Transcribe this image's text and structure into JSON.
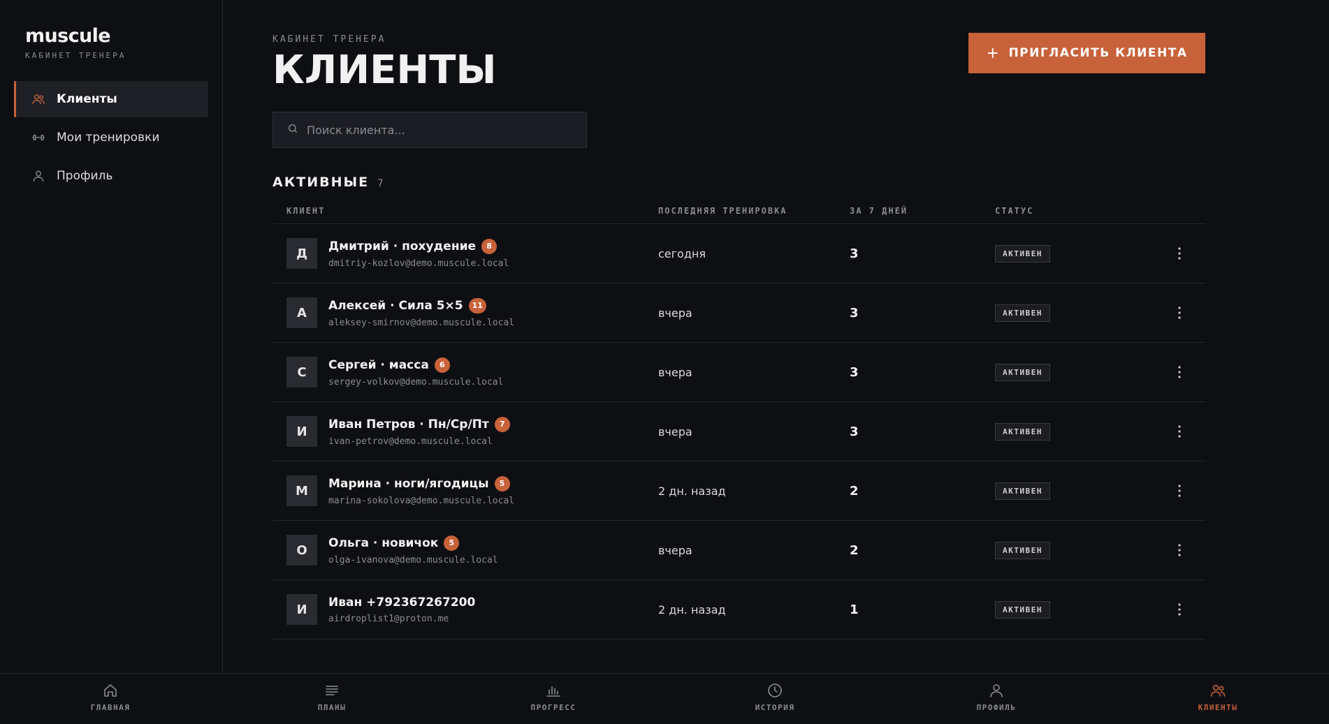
{
  "brand": {
    "name": "muscule",
    "subtitle": "КАБИНЕТ ТРЕНЕРА"
  },
  "sidebar": {
    "items": [
      {
        "label": "Клиенты",
        "icon": "users-icon",
        "active": true
      },
      {
        "label": "Мои тренировки",
        "icon": "dumbbell-icon",
        "active": false
      },
      {
        "label": "Профиль",
        "icon": "user-icon",
        "active": false
      }
    ]
  },
  "header": {
    "eyebrow": "КАБИНЕТ ТРЕНЕРА",
    "title": "КЛИЕНТЫ",
    "invite_label": "ПРИГЛАСИТЬ КЛИЕНТА"
  },
  "search": {
    "placeholder": "Поиск клиента...",
    "value": ""
  },
  "section": {
    "title": "АКТИВНЫЕ",
    "count": "7"
  },
  "table": {
    "columns": [
      "КЛИЕНТ",
      "ПОСЛЕДНЯЯ ТРЕНИРОВКА",
      "ЗА 7 ДНЕЙ",
      "СТАТУС"
    ],
    "rows": [
      {
        "initial": "Д",
        "name": "Дмитрий · похудение",
        "badge": "8",
        "email": "dmitriy-kozlov@demo.muscule.local",
        "last": "сегодня",
        "week": "3",
        "status": "АКТИВЕН"
      },
      {
        "initial": "А",
        "name": "Алексей · Сила 5×5",
        "badge": "11",
        "email": "aleksey-smirnov@demo.muscule.local",
        "last": "вчера",
        "week": "3",
        "status": "АКТИВЕН"
      },
      {
        "initial": "С",
        "name": "Сергей · масса",
        "badge": "6",
        "email": "sergey-volkov@demo.muscule.local",
        "last": "вчера",
        "week": "3",
        "status": "АКТИВЕН"
      },
      {
        "initial": "И",
        "name": "Иван Петров · Пн/Ср/Пт",
        "badge": "7",
        "email": "ivan-petrov@demo.muscule.local",
        "last": "вчера",
        "week": "3",
        "status": "АКТИВЕН"
      },
      {
        "initial": "М",
        "name": "Марина · ноги/ягодицы",
        "badge": "5",
        "email": "marina-sokolova@demo.muscule.local",
        "last": "2 дн. назад",
        "week": "2",
        "status": "АКТИВЕН"
      },
      {
        "initial": "О",
        "name": "Ольга · новичок",
        "badge": "5",
        "email": "olga-ivanova@demo.muscule.local",
        "last": "вчера",
        "week": "2",
        "status": "АКТИВЕН"
      },
      {
        "initial": "И",
        "name": "Иван +792367267200",
        "badge": null,
        "email": "airdroplist1@proton.me",
        "last": "2 дн. назад",
        "week": "1",
        "status": "АКТИВЕН"
      }
    ]
  },
  "bottom_nav": [
    {
      "label": "ГЛАВНАЯ",
      "icon": "home-icon",
      "active": false
    },
    {
      "label": "ПЛАНЫ",
      "icon": "list-icon",
      "active": false
    },
    {
      "label": "ПРОГРЕСС",
      "icon": "bar-chart-icon",
      "active": false
    },
    {
      "label": "ИСТОРИЯ",
      "icon": "clock-icon",
      "active": false
    },
    {
      "label": "ПРОФИЛЬ",
      "icon": "user-icon",
      "active": false
    },
    {
      "label": "КЛИЕНТЫ",
      "icon": "users-icon",
      "active": true
    }
  ],
  "colors": {
    "accent": "#c8623a",
    "background": "#0e0f13",
    "muted": "#8b8d93"
  }
}
